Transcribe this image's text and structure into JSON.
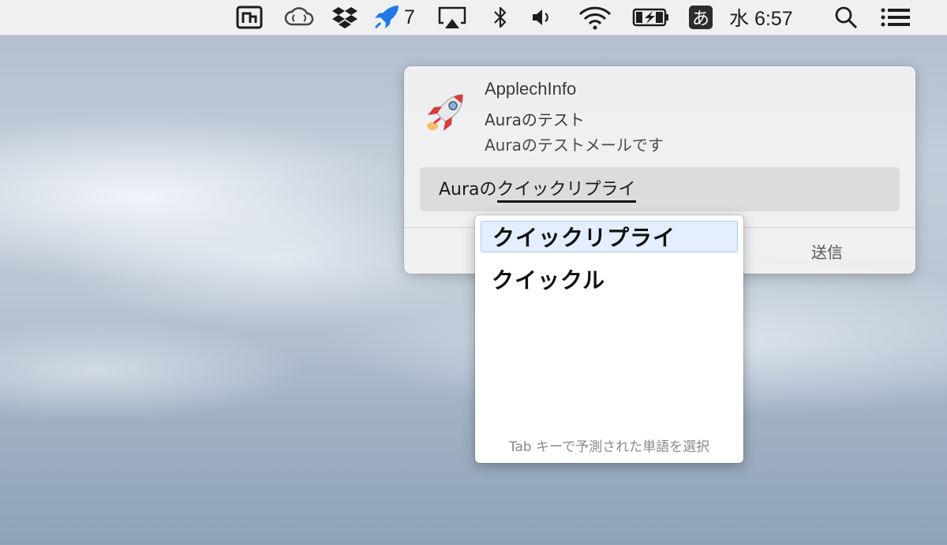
{
  "menubar": {
    "rocket_badge": "7",
    "ime_label": "あ",
    "clock": "水 6:57",
    "icons": [
      "pocket-app-icon",
      "creative-cloud-icon",
      "dropbox-icon",
      "rocket-icon",
      "airplay-icon",
      "bluetooth-icon",
      "volume-icon",
      "wifi-icon",
      "battery-charging-icon",
      "input-source-icon",
      "spotlight-search-icon",
      "notification-center-icon"
    ]
  },
  "notification": {
    "app_name": "ApplechInfo",
    "subtitle": "Auraのテスト",
    "body": "Auraのテストメールです",
    "reply": {
      "committed": "Aura",
      "committed_particle": "の",
      "marked": "クイックリプライ"
    },
    "send_label": "送信"
  },
  "candidates": {
    "items": [
      "クイックリプライ",
      "クイックル"
    ],
    "selected_index": 0,
    "hint": "Tab キーで予測された単語を選択"
  },
  "colors": {
    "menubar_bg": "#f2f2f4",
    "selected_candidate": "#e3efff",
    "reply_field": "#dcdcdd"
  }
}
